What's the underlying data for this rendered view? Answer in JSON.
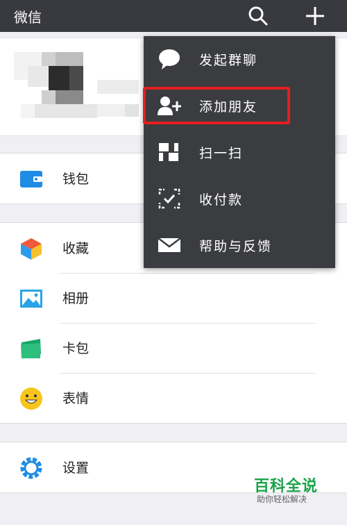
{
  "app": {
    "title": "微信"
  },
  "topbar": {
    "icons": [
      "search-icon",
      "plus-icon"
    ]
  },
  "list": {
    "group1": [
      {
        "label": "钱包",
        "icon": "wallet-icon"
      }
    ],
    "group2": [
      {
        "label": "收藏",
        "icon": "favorites-cube-icon"
      },
      {
        "label": "相册",
        "icon": "album-icon"
      },
      {
        "label": "卡包",
        "icon": "card-pack-icon"
      },
      {
        "label": "表情",
        "icon": "smiley-icon"
      }
    ],
    "group3": [
      {
        "label": "设置",
        "icon": "gear-icon"
      }
    ]
  },
  "menu": {
    "items": [
      {
        "label": "发起群聊",
        "icon": "chat-bubble-icon"
      },
      {
        "label": "添加朋友",
        "icon": "add-contact-icon"
      },
      {
        "label": "扫一扫",
        "icon": "scan-icon"
      },
      {
        "label": "收付款",
        "icon": "pay-icon"
      },
      {
        "label": "帮助与反馈",
        "icon": "mail-icon"
      }
    ]
  },
  "watermark": {
    "title": "百科全说",
    "subtitle": "助你轻松解决"
  },
  "colors": {
    "topbar": "#393a3f",
    "menu": "#3b3c40",
    "highlight": "#e41e1e",
    "accent": "#1aa24a"
  }
}
